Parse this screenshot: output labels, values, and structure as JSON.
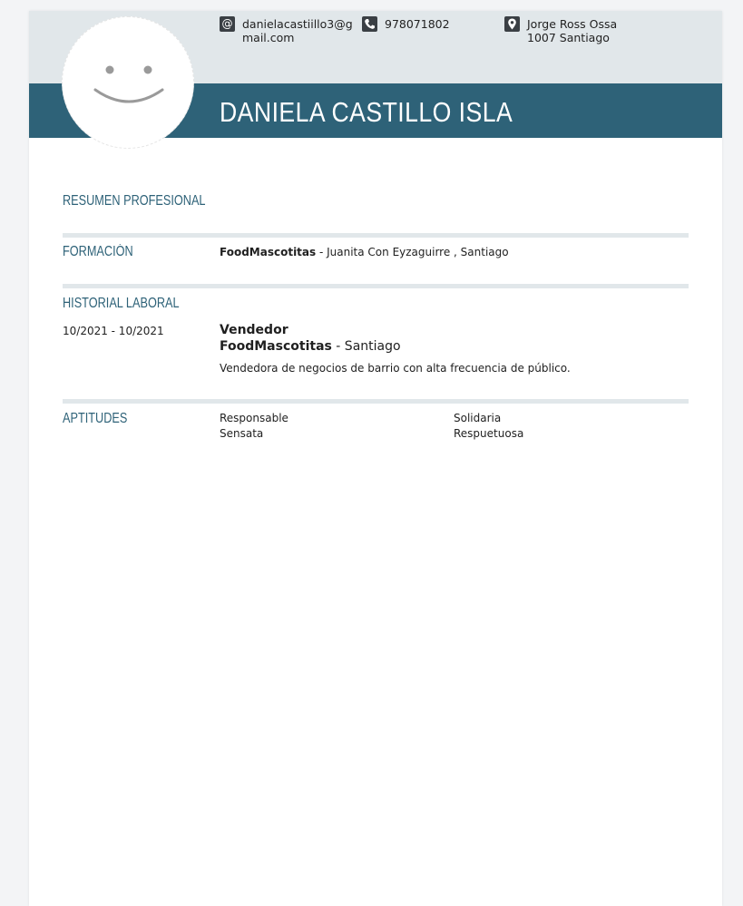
{
  "header": {
    "name": "DANIELA CASTILLO ISLA",
    "email_line1": "danielacastiillo3@g",
    "email_line2": "mail.com",
    "phone": "978071802",
    "address_line1": "Jorge Ross Ossa",
    "address_line2": "1007 Santiago",
    "icons": [
      "at-icon",
      "phone-icon",
      "location-pin-icon"
    ]
  },
  "sections": {
    "summary": {
      "title": "RESUMEN PROFESIONAL"
    },
    "education": {
      "title": "FORMACIÓN",
      "institution": "FoodMascotitas",
      "detail": " - Juanita Con Eyzaguirre , Santiago"
    },
    "work": {
      "title": "HISTORIAL LABORAL",
      "dates": "10/2021 - 10/2021",
      "position": "Vendedor",
      "company": "FoodMascotitas",
      "location": " - Santiago",
      "description": "Vendedora de negocios de barrio con alta frecuencia de público."
    },
    "skills": {
      "title": "APTITUDES",
      "items": [
        "Responsable",
        "Solidaria",
        "Sensata",
        "Respuetuosa"
      ]
    }
  },
  "colors": {
    "accent": "#2e6278",
    "band": "#e1e7ea",
    "page_bg": "#f3f4f6"
  }
}
